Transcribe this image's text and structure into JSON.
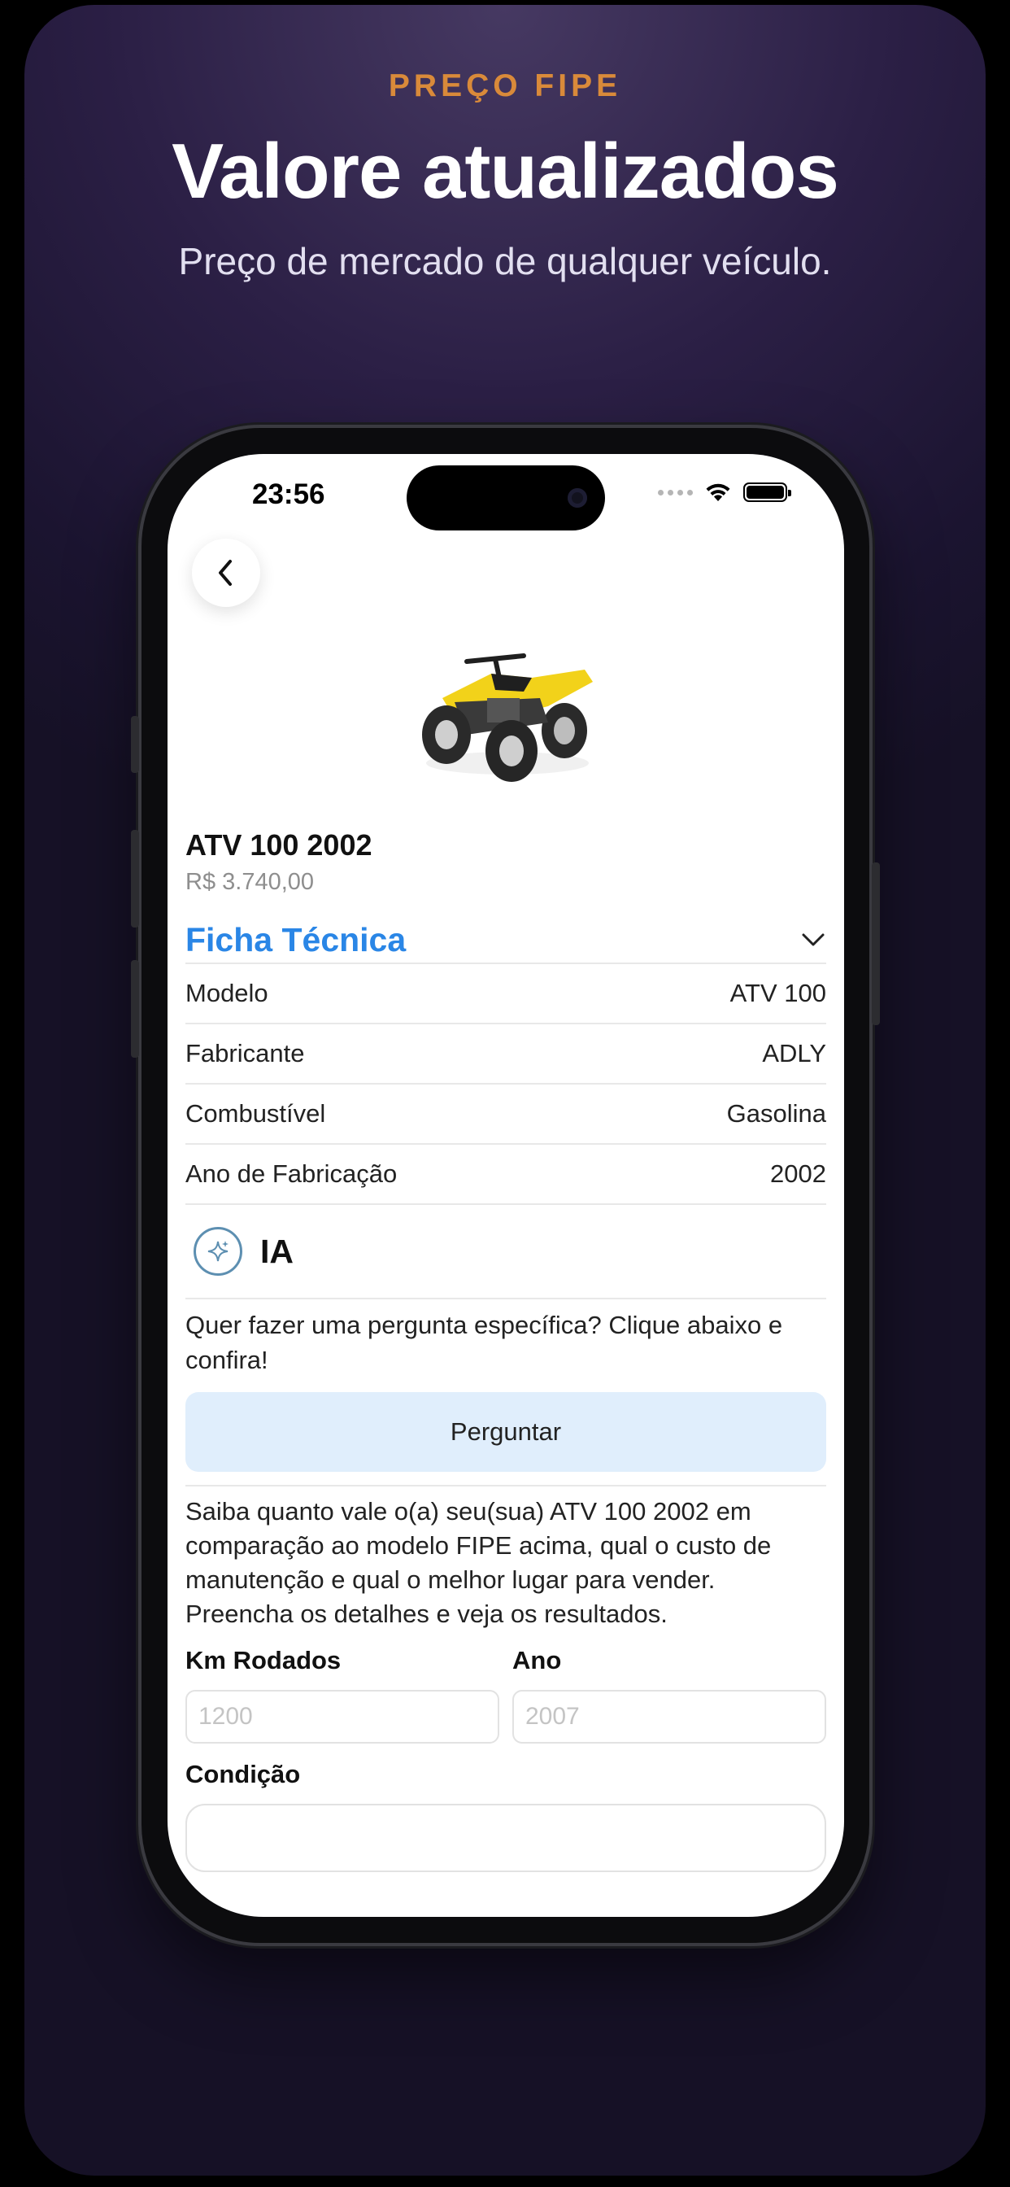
{
  "promo": {
    "eyebrow": "PREÇO FIPE",
    "headline": "Valore atualizados",
    "subtitle": "Preço de mercado de qualquer veículo."
  },
  "status_bar": {
    "time": "23:56",
    "icons": [
      "signal-dots-icon",
      "wifi-icon",
      "battery-icon"
    ]
  },
  "header": {
    "back_icon": "chevron-left-icon"
  },
  "vehicle": {
    "image": "atv-quad-bike-image",
    "title": "ATV 100 2002",
    "price": "R$ 3.740,00"
  },
  "ficha": {
    "title": "Ficha Técnica",
    "toggle_icon": "chevron-down-icon",
    "rows": [
      {
        "label": "Modelo",
        "value": "ATV 100"
      },
      {
        "label": "Fabricante",
        "value": "ADLY"
      },
      {
        "label": "Combustível",
        "value": "Gasolina"
      },
      {
        "label": "Ano de Fabricação",
        "value": "2002"
      }
    ]
  },
  "ia": {
    "icon": "sparkle-icon",
    "label": "IA",
    "question": "Quer fazer uma pergunta específica? Clique abaixo e confira!",
    "button": "Perguntar",
    "info": "Saiba quanto vale o(a) seu(sua) ATV 100 2002 em comparação ao modelo FIPE acima, qual o custo de manutenção e qual o melhor lugar para vender. Preencha os detalhes e veja os resultados."
  },
  "form": {
    "km_label": "Km Rodados",
    "km_placeholder": "1200",
    "ano_label": "Ano",
    "ano_placeholder": "2007",
    "condicao_label": "Condição"
  },
  "colors": {
    "accent": "#2a86e6",
    "eyebrow": "#d98a3a",
    "button_bg": "#e0eefc"
  }
}
